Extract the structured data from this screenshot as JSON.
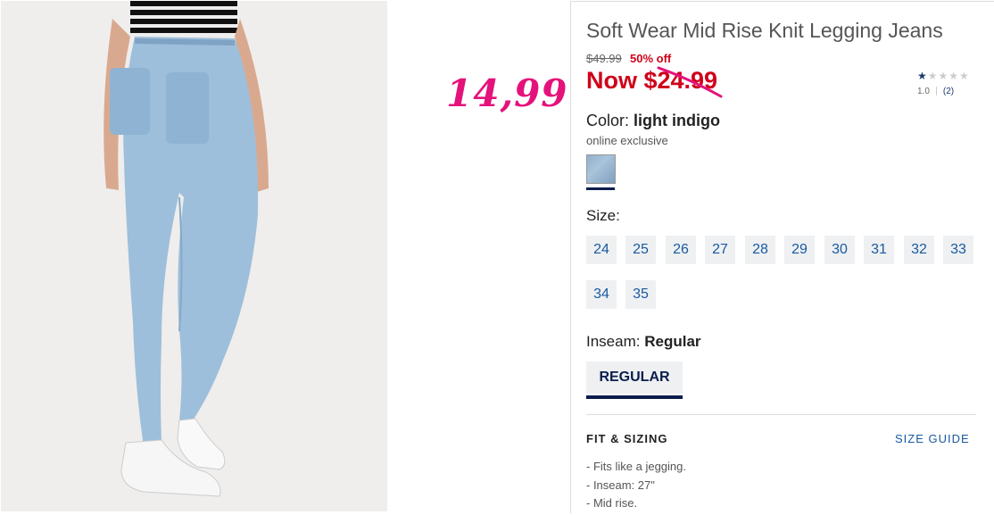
{
  "overlay": {
    "handwritten_price": "14,99"
  },
  "product": {
    "title": "Soft Wear Mid Rise Knit Legging Jeans",
    "original_price": "$49.99",
    "discount": "50% off",
    "now_price": "Now $24.99",
    "rating": {
      "stars_filled": 1,
      "stars_total": 5,
      "value": "1.0",
      "count": "(2)"
    },
    "color": {
      "label": "Color:",
      "value": "light indigo",
      "note": "online exclusive",
      "swatch_color": "#9ab7d2"
    },
    "size": {
      "label": "Size:",
      "options": [
        "24",
        "25",
        "26",
        "27",
        "28",
        "29",
        "30",
        "31",
        "32",
        "33",
        "34",
        "35"
      ]
    },
    "inseam": {
      "label": "Inseam:",
      "value": "Regular",
      "options": [
        "REGULAR"
      ]
    },
    "fit_sizing": {
      "title": "FIT & SIZING",
      "size_guide": "SIZE GUIDE",
      "bullets": [
        "- Fits like a jegging.",
        "- Inseam: 27\"",
        "- Mid rise."
      ]
    }
  },
  "colors": {
    "sale_red": "#d0021b",
    "navy": "#0b1d4d",
    "link_blue": "#1a5aa0",
    "overlay_pink": "#e4127b"
  }
}
